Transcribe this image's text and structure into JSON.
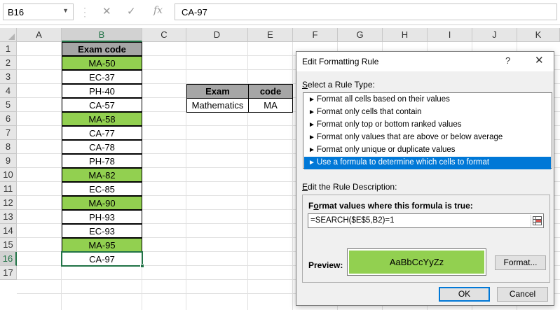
{
  "formula_bar": {
    "name_box": "B16",
    "cancel_glyph": "✕",
    "enter_glyph": "✓",
    "fx_label": "fx",
    "formula": "CA-97"
  },
  "columns": [
    "A",
    "B",
    "C",
    "D",
    "E",
    "F",
    "G",
    "H",
    "I",
    "J",
    "K"
  ],
  "rows": [
    "1",
    "2",
    "3",
    "4",
    "5",
    "6",
    "7",
    "8",
    "9",
    "10",
    "11",
    "12",
    "13",
    "14",
    "15",
    "16",
    "17"
  ],
  "exam_codes": {
    "header": "Exam code",
    "values": [
      "MA-50",
      "EC-37",
      "PH-40",
      "CA-57",
      "MA-58",
      "CA-77",
      "CA-78",
      "PH-78",
      "MA-82",
      "EC-85",
      "MA-90",
      "PH-93",
      "EC-93",
      "MA-95",
      "CA-97"
    ],
    "highlighted": [
      true,
      false,
      false,
      false,
      true,
      false,
      false,
      false,
      true,
      false,
      true,
      false,
      false,
      true,
      false
    ]
  },
  "lookup_table": {
    "header_exam": "Exam",
    "header_code": "code",
    "exam": "Mathematics",
    "code": "MA"
  },
  "colors": {
    "highlight": "#92d050",
    "header_fill": "#a6a6a6",
    "selection": "#0078d7",
    "excel_green": "#217346"
  },
  "dialog": {
    "title": "Edit Formatting Rule",
    "help": "?",
    "close": "✕",
    "select_rule_label_u": "S",
    "select_rule_label_rest": "elect a Rule Type:",
    "rule_types": [
      "Format all cells based on their values",
      "Format only cells that contain",
      "Format only top or bottom ranked values",
      "Format only values that are above or below average",
      "Format only unique or duplicate values",
      "Use a formula to determine which cells to format"
    ],
    "selected_rule_index": 5,
    "edit_desc_label_u": "E",
    "edit_desc_label_rest": "dit the Rule Description:",
    "formula_label_pre": "F",
    "formula_label_u": "o",
    "formula_label_rest": "rmat values where this formula is true:",
    "formula_value": "=SEARCH($E$5,B2)=1",
    "preview_label": "Preview:",
    "preview_text": "AaBbCcYyZz",
    "format_button": "Format...",
    "ok_button": "OK",
    "cancel_button": "Cancel"
  }
}
